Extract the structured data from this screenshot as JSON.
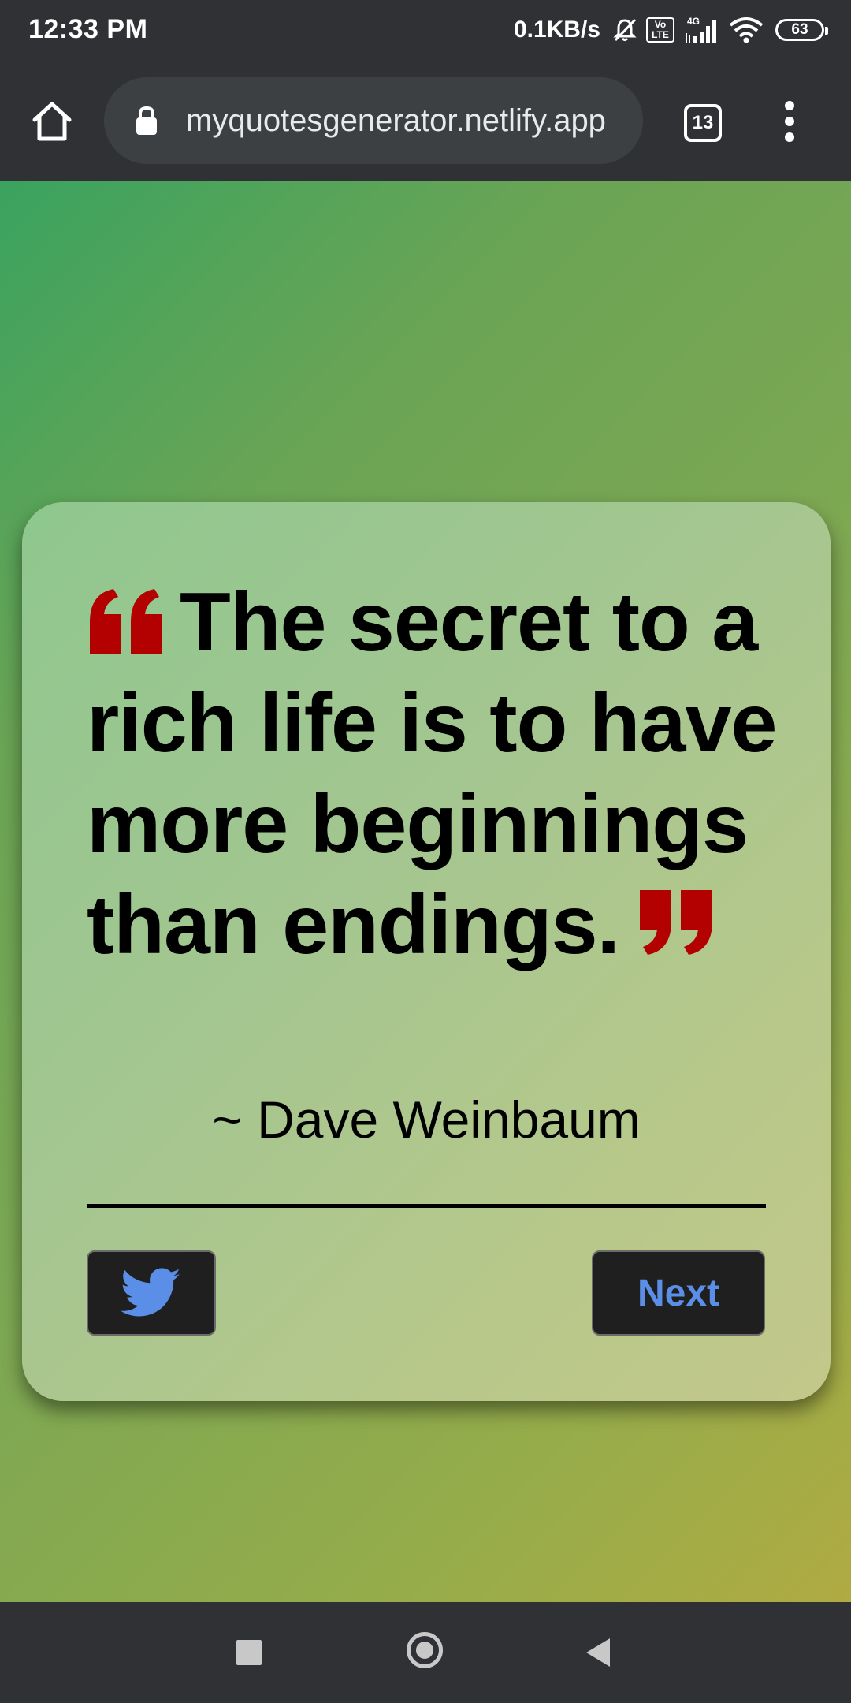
{
  "status_bar": {
    "time": "12:33 PM",
    "net_speed": "0.1KB/s",
    "volte_label": "Vo\nLTE",
    "network_label": "4G",
    "battery": "63",
    "icons": [
      "mute-icon",
      "volte-icon",
      "signal-icon",
      "wifi-icon",
      "battery-icon"
    ]
  },
  "browser": {
    "url": "myquotesgenerator.netlify.app",
    "tab_count": "13",
    "icons": [
      "home-icon",
      "lock-icon",
      "tabs-icon",
      "more-vert-icon"
    ]
  },
  "quote_card": {
    "quote_text": "The secret to a rich life is to have more beginnings than endings.",
    "author": "~ Dave Weinbaum",
    "next_label": "Next",
    "quote_mark_color": "#b30000",
    "button_text_color": "#5b8ee6",
    "icons": [
      "quote-left-icon",
      "quote-right-icon",
      "twitter-icon"
    ]
  },
  "nav_bar": {
    "icons": [
      "recents-icon",
      "home-nav-icon",
      "back-icon"
    ]
  }
}
